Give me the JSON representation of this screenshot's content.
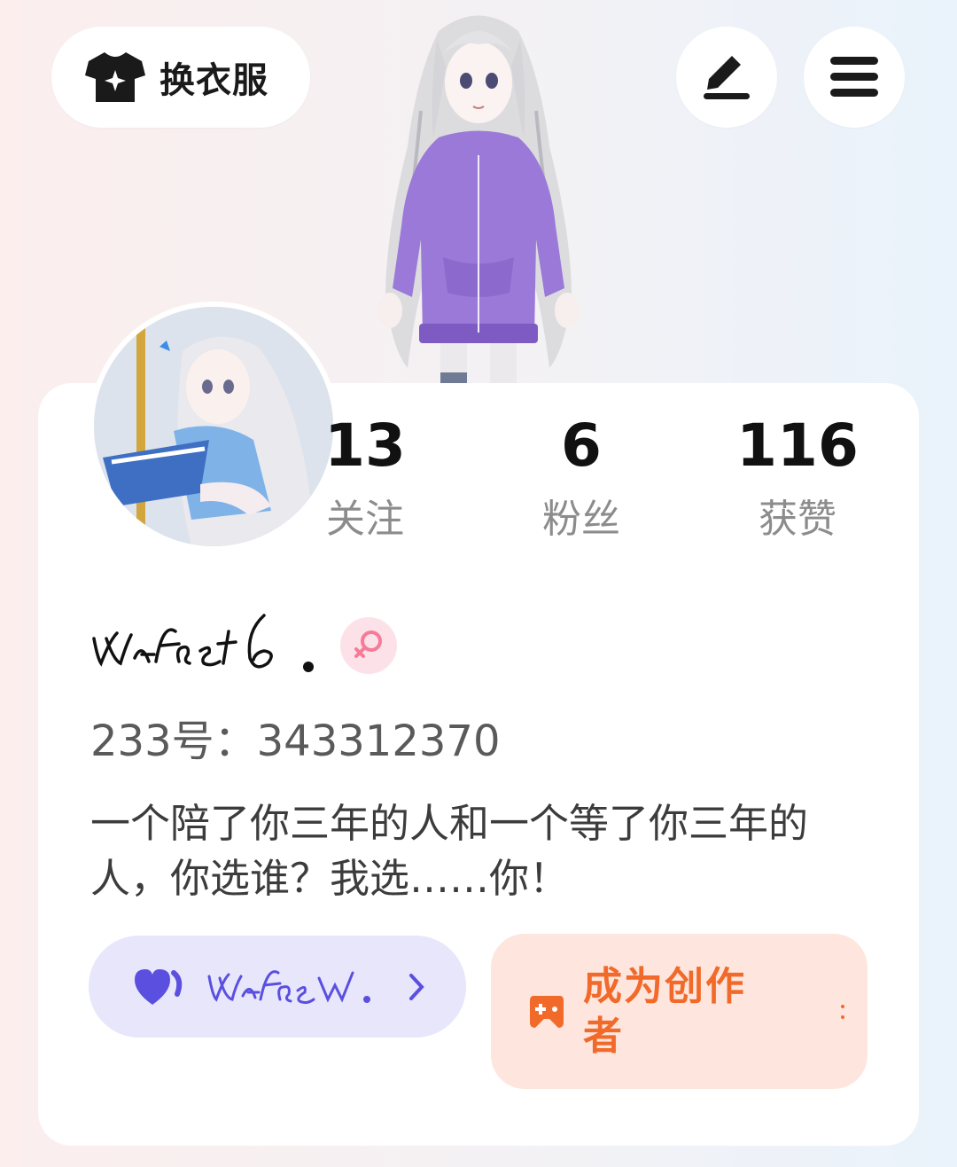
{
  "header": {
    "outfit_label": "换衣服",
    "edit_icon": "edit-pen-icon",
    "menu_icon": "menu-icon"
  },
  "profile": {
    "stats": [
      {
        "value": "13",
        "label": "关注"
      },
      {
        "value": "6",
        "label": "粉丝"
      },
      {
        "value": "116",
        "label": "获赞"
      }
    ],
    "nickname": "vr.afe6.",
    "gender_icon": "female-icon",
    "id_label": "233号：",
    "id_value": "343312370",
    "bio": "一个陪了你三年的人和一个等了你三年的人，你选谁？我选……你！"
  },
  "actions": {
    "guild_name": "vr.afew.",
    "creator_label": "成为创作者"
  },
  "colors": {
    "guild_bg": "#e7e6fb",
    "guild_accent": "#5b4fe0",
    "creator_bg": "#fee6de",
    "creator_accent": "#f26a2a",
    "female_pink": "#f57b98"
  }
}
